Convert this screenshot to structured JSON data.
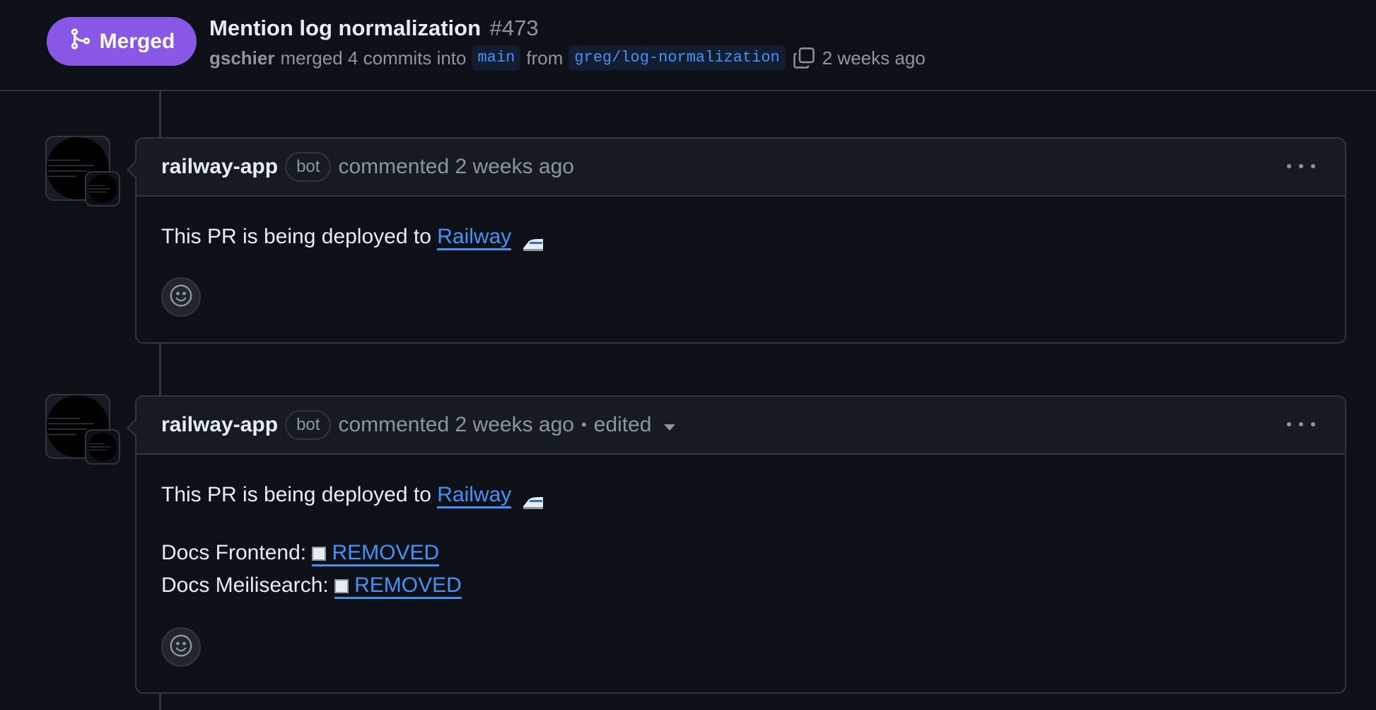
{
  "pr": {
    "status_label": "Merged",
    "title": "Mention log normalization",
    "number": "#473",
    "author": "gschier",
    "merge_text": "merged 4 commits into",
    "base_branch": "main",
    "from_text": "from",
    "head_branch": "greg/log-normalization",
    "time": "2 weeks ago"
  },
  "comments": [
    {
      "author": "railway-app",
      "badge": "bot",
      "action": "commented 2 weeks ago",
      "body_prefix": "This PR is being deployed to ",
      "link_text": "Railway",
      "emoji": "train-emoji"
    },
    {
      "author": "railway-app",
      "badge": "bot",
      "action": "commented 2 weeks ago",
      "separator": "•",
      "edited": "edited",
      "body_prefix": "This PR is being deployed to ",
      "link_text": "Railway",
      "emoji": "train-emoji",
      "services": [
        {
          "label": "Docs Frontend: ",
          "status": "REMOVED"
        },
        {
          "label": "Docs Meilisearch: ",
          "status": "REMOVED"
        }
      ]
    }
  ],
  "colors": {
    "merged": "#8957e5",
    "link": "#4493f8",
    "background": "#0d1117",
    "border": "#30363d"
  }
}
